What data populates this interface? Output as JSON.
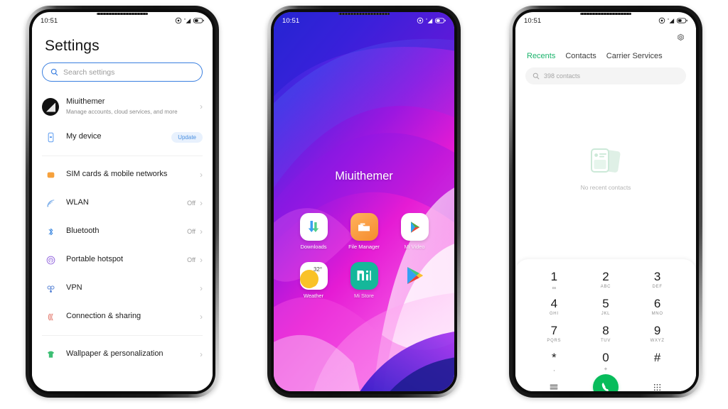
{
  "phones": {
    "settings": {
      "status_bar": {
        "time": "10:51",
        "icons": [
          "alarm-icon",
          "signal-icon",
          "battery-icon"
        ]
      },
      "title": "Settings",
      "search": {
        "placeholder": "Search settings",
        "icon": "search-icon"
      },
      "account": {
        "name": "Miuithemer",
        "subtitle": "Manage accounts, cloud services, and more",
        "avatar": "user-avatar",
        "chevron": "chevron-right-icon"
      },
      "groups": [
        {
          "items": [
            {
              "label": "My device",
              "icon": "phone-device-icon",
              "badge": "Update",
              "value": "",
              "chevron": false
            }
          ]
        },
        {
          "items": [
            {
              "label": "SIM cards & mobile networks",
              "icon": "sim-card-icon",
              "value": "",
              "chevron": true
            },
            {
              "label": "WLAN",
              "icon": "wifi-icon",
              "value": "Off",
              "chevron": true
            },
            {
              "label": "Bluetooth",
              "icon": "bluetooth-icon",
              "value": "Off",
              "chevron": true
            },
            {
              "label": "Portable hotspot",
              "icon": "hotspot-icon",
              "value": "Off",
              "chevron": true
            },
            {
              "label": "VPN",
              "icon": "vpn-icon",
              "value": "",
              "chevron": true
            },
            {
              "label": "Connection & sharing",
              "icon": "connection-sharing-icon",
              "value": "",
              "chevron": true
            }
          ]
        },
        {
          "items": [
            {
              "label": "Wallpaper & personalization",
              "icon": "tshirt-icon",
              "value": "",
              "chevron": true
            }
          ]
        }
      ]
    },
    "home": {
      "status_bar": {
        "time": "10:51",
        "icons": [
          "alarm-icon",
          "signal-icon",
          "battery-icon"
        ]
      },
      "widget_title": "Miuithemer",
      "apps": [
        [
          {
            "label": "Downloads",
            "icon": "downloads-icon"
          },
          {
            "label": "File Manager",
            "icon": "file-manager-icon"
          },
          {
            "label": "Mi Video",
            "icon": "mi-video-icon"
          }
        ],
        [
          {
            "label": "Weather",
            "icon": "weather-icon",
            "temperature": "32°"
          },
          {
            "label": "Mi Store",
            "icon": "mi-store-icon"
          },
          {
            "label": "",
            "icon": "play-store-icon"
          }
        ]
      ],
      "wallpaper_colors": [
        "#2f2fd8",
        "#6a19e0",
        "#c714e0",
        "#ef38d8",
        "#ffffff"
      ]
    },
    "dialer": {
      "status_bar": {
        "time": "10:51",
        "icons": [
          "alarm-icon",
          "signal-icon",
          "battery-icon"
        ]
      },
      "settings_icon": "gear-icon",
      "tabs": [
        {
          "label": "Recents",
          "active": true
        },
        {
          "label": "Contacts",
          "active": false
        },
        {
          "label": "Carrier Services",
          "active": false
        }
      ],
      "search": {
        "placeholder": "398 contacts",
        "icon": "search-icon"
      },
      "empty_state": {
        "text": "No recent contacts",
        "illustration": "contact-cards-illustration"
      },
      "keypad": [
        {
          "num": "1",
          "sub": "∞"
        },
        {
          "num": "2",
          "sub": "ABC"
        },
        {
          "num": "3",
          "sub": "DEF"
        },
        {
          "num": "4",
          "sub": "GHI"
        },
        {
          "num": "5",
          "sub": "JKL"
        },
        {
          "num": "6",
          "sub": "MNO"
        },
        {
          "num": "7",
          "sub": "PQRS"
        },
        {
          "num": "8",
          "sub": "TUV"
        },
        {
          "num": "9",
          "sub": "WXYZ"
        },
        {
          "num": "*",
          "sub": ","
        },
        {
          "num": "0",
          "sub": "+"
        },
        {
          "num": "#",
          "sub": ""
        }
      ],
      "actions": {
        "menu": "menu-icon",
        "call": "call-icon",
        "keypad_toggle": "dialpad-icon"
      },
      "accent": "#07bc5b"
    }
  }
}
